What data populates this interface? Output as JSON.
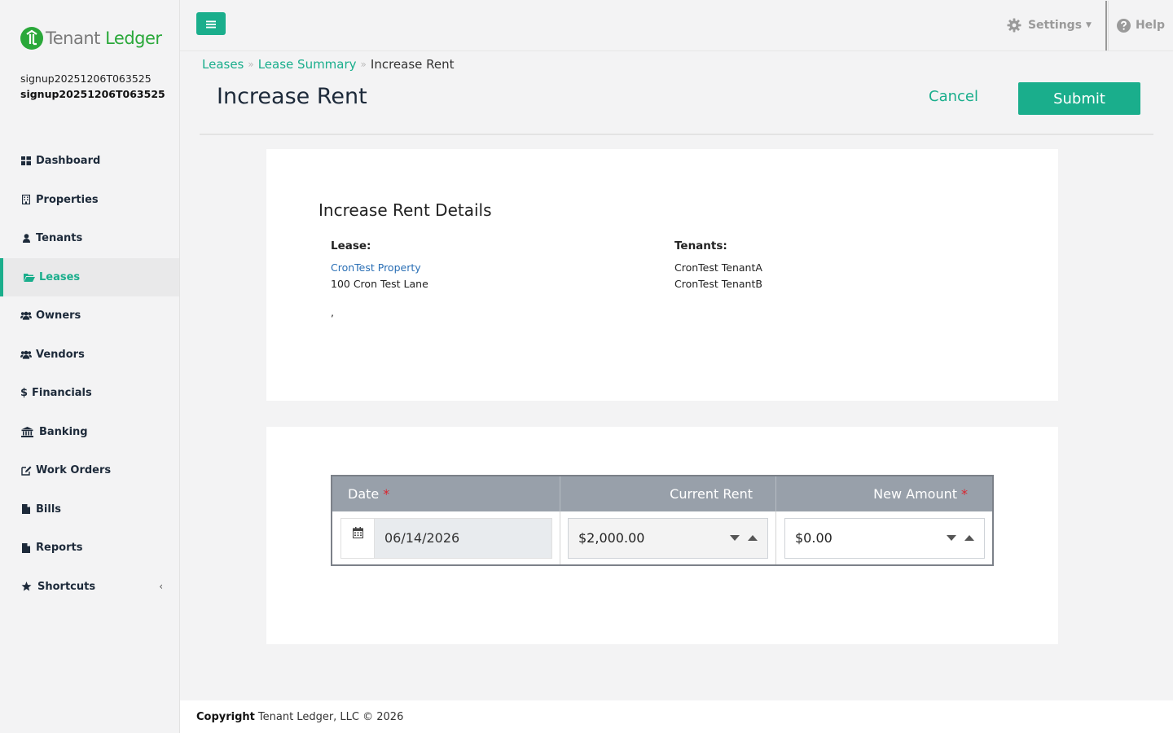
{
  "app": {
    "logo_part1": "Tenant",
    "logo_part2": "Ledger",
    "accent_color": "#1aae8c",
    "brand_color": "#2aa83a"
  },
  "user": {
    "line1": "signup20251206T063525",
    "line2": "signup20251206T063525"
  },
  "sidebar": {
    "items": [
      {
        "label": "Dashboard",
        "icon": "dashboard-icon"
      },
      {
        "label": "Properties",
        "icon": "building-icon"
      },
      {
        "label": "Tenants",
        "icon": "user-icon"
      },
      {
        "label": "Leases",
        "icon": "folder-open-icon",
        "active": true
      },
      {
        "label": "Owners",
        "icon": "users-icon"
      },
      {
        "label": "Vendors",
        "icon": "users-icon"
      },
      {
        "label": "Financials",
        "icon": "dollar-icon"
      },
      {
        "label": "Banking",
        "icon": "bank-icon"
      },
      {
        "label": "Work Orders",
        "icon": "edit-icon"
      },
      {
        "label": "Bills",
        "icon": "file-icon"
      },
      {
        "label": "Reports",
        "icon": "file-icon"
      },
      {
        "label": "Shortcuts",
        "icon": "star-icon"
      }
    ]
  },
  "topbar": {
    "settings_label": "Settings",
    "help_label": "Help"
  },
  "breadcrumb": {
    "items": [
      "Leases",
      "Lease Summary",
      "Increase Rent"
    ]
  },
  "page": {
    "title": "Increase Rent",
    "cancel_label": "Cancel",
    "submit_label": "Submit"
  },
  "details": {
    "section_title": "Increase Rent Details",
    "lease_label": "Lease:",
    "lease_property": "CronTest Property",
    "lease_address": "100 Cron Test Lane",
    "lease_city_line": ",",
    "tenants_label": "Tenants:",
    "tenants": [
      "CronTest TenantA",
      "CronTest TenantB"
    ]
  },
  "rent_table": {
    "headers": {
      "date": "Date",
      "current_rent": "Current Rent",
      "new_amount": "New Amount"
    },
    "required_mark": "*",
    "date_value": "06/14/2026",
    "current_rent_value": "$2,000.00",
    "new_amount_value": "$0.00"
  },
  "footer": {
    "copyright_label": "Copyright",
    "copyright_text": "Tenant Ledger, LLC © 2026"
  }
}
